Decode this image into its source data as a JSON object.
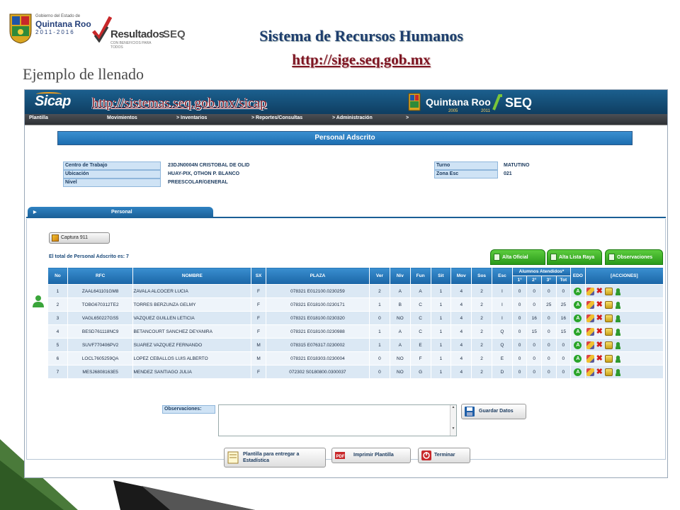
{
  "slide": {
    "title": "Sistema de Recursos Humanos",
    "link": "http://sige.seq.gob.mx",
    "subtitle": "Ejemplo de llenado",
    "logos": {
      "gov_line1": "Gobierno del Estado de",
      "gov_line2": "Quintana Roo",
      "gov_years": "2011-2016",
      "resultados": "Resultados",
      "resultados_sub": "CON BENEFICIOS PARA TODOS",
      "seq": "SEQ"
    }
  },
  "app": {
    "logo": "Sicap",
    "url": "http://sistemas.seq.gob.mx/sicap",
    "banner_brand": "Quintana Roo",
    "banner_years_left": "2005",
    "banner_years_right": "2011",
    "banner_seq": "SEQ",
    "menu": [
      {
        "label": "Plantilla"
      },
      {
        "label": "Movimientos"
      },
      {
        "label": "> Inventarios"
      },
      {
        "label": "> Reportes/Consultas"
      },
      {
        "label": "> Administración"
      },
      {
        "label": ">"
      }
    ],
    "section_title": "Personal Adscrito",
    "info": {
      "centro_label": "Centro de Trabajo",
      "centro_value": "23DJN0004N CRISTOBAL DE OLID",
      "ubicacion_label": "Ubicación",
      "ubicacion_value": "HUAY-PIX, OTHON P. BLANCO",
      "nivel_label": "Nivel",
      "nivel_value": "PREESCOLAR/GENERAL",
      "turno_label": "Turno",
      "turno_value": "MATUTINO",
      "zona_label": "Zona Esc",
      "zona_value": "021"
    },
    "tab_label": "Personal",
    "captura_button": "Captura 911",
    "total_text": "El total de Personal Adscrito es: 7",
    "green_tabs": [
      {
        "label": "Alta Oficial"
      },
      {
        "label": "Alta Lista Raya"
      },
      {
        "label": "Observaciones"
      }
    ],
    "table": {
      "headers": {
        "no": "No",
        "rfc": "RFC",
        "nombre": "NOMBRE",
        "sx": "SX",
        "plaza": "PLAZA",
        "ver": "Ver",
        "niv": "Niv",
        "fun": "Fun",
        "sit": "Sit",
        "mov": "Mov",
        "sos": "Sos",
        "esc": "Esc",
        "alumnos": "Alumnos Atendidos*",
        "g1": "1°",
        "g2": "2°",
        "g3": "3°",
        "tot": "Tot",
        "edo": "EDO",
        "acciones": "[ACCIONES]"
      },
      "rows": [
        {
          "no": "1",
          "rfc": "ZAAL641101GM8",
          "nombre": "ZAVALA ALCOCER LUCIA",
          "sx": "F",
          "plaza": "078321 E012100.0230259",
          "ver": "2",
          "niv": "A",
          "fun": "A",
          "sit": "1",
          "mov": "4",
          "sos": "2",
          "esc": "I",
          "g1": "0",
          "g2": "0",
          "g3": "0",
          "tot": "0"
        },
        {
          "no": "2",
          "rfc": "TOBG670312TE2",
          "nombre": "TORRES BERZUNZA GELMY",
          "sx": "F",
          "plaza": "078321 E018100.0230171",
          "ver": "1",
          "niv": "B",
          "fun": "C",
          "sit": "1",
          "mov": "4",
          "sos": "2",
          "esc": "I",
          "g1": "0",
          "g2": "0",
          "g3": "25",
          "tot": "25"
        },
        {
          "no": "3",
          "rfc": "VAGL650227GS5",
          "nombre": "VAZQUEZ GUILLEN LETICIA",
          "sx": "F",
          "plaza": "078321 E018100.0230320",
          "ver": "0",
          "niv": "NO",
          "fun": "C",
          "sit": "1",
          "mov": "4",
          "sos": "2",
          "esc": "I",
          "g1": "0",
          "g2": "16",
          "g3": "0",
          "tot": "16"
        },
        {
          "no": "4",
          "rfc": "BESD761118NC9",
          "nombre": "BETANCOURT SANCHEZ DEYANIRA",
          "sx": "F",
          "plaza": "078321 E018100.0230988",
          "ver": "1",
          "niv": "A",
          "fun": "C",
          "sit": "1",
          "mov": "4",
          "sos": "2",
          "esc": "Q",
          "g1": "0",
          "g2": "15",
          "g3": "0",
          "tot": "15"
        },
        {
          "no": "5",
          "rfc": "SUVF770406PV2",
          "nombre": "SUAREZ VAZQUEZ FERNANDO",
          "sx": "M",
          "plaza": "078315 E076317.0230002",
          "ver": "1",
          "niv": "A",
          "fun": "E",
          "sit": "1",
          "mov": "4",
          "sos": "2",
          "esc": "Q",
          "g1": "0",
          "g2": "0",
          "g3": "0",
          "tot": "0"
        },
        {
          "no": "6",
          "rfc": "LOCL7605259QA",
          "nombre": "LOPEZ CEBALLOS LUIS ALBERTO",
          "sx": "M",
          "plaza": "078321 E018303.0230004",
          "ver": "0",
          "niv": "NO",
          "fun": "F",
          "sit": "1",
          "mov": "4",
          "sos": "2",
          "esc": "E",
          "g1": "0",
          "g2": "0",
          "g3": "0",
          "tot": "0"
        },
        {
          "no": "7",
          "rfc": "MESJ6808163E5",
          "nombre": "MENDEZ SANTIAGO JULIA",
          "sx": "F",
          "plaza": "072302 S0180800.0300037",
          "ver": "0",
          "niv": "NO",
          "fun": "G",
          "sit": "1",
          "mov": "4",
          "sos": "2",
          "esc": "D",
          "g1": "0",
          "g2": "0",
          "g3": "0",
          "tot": "0"
        }
      ]
    },
    "observaciones_label": "Observaciones:",
    "observaciones_value": "",
    "guardar_button": "Guardar Datos",
    "plantilla_button": "Plantilla para entregar a Estadística",
    "imprimir_button": "Imprimir Plantilla",
    "terminar_button": "Terminar"
  }
}
